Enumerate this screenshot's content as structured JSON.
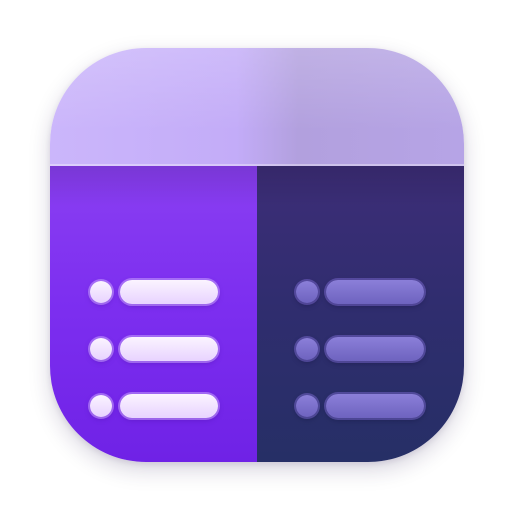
{
  "icon": {
    "name": "list-columns-app-icon",
    "colors": {
      "header": "#c3acf8",
      "left_column": "#7d2ff0",
      "right_column": "#2f2d6e",
      "light_item": "#f1e4ff",
      "dim_item": "#7b70cc"
    },
    "left_rows": [
      {
        "kind": "bullet-line"
      },
      {
        "kind": "bullet-line"
      },
      {
        "kind": "bullet-line"
      }
    ],
    "right_rows": [
      {
        "kind": "bullet-line"
      },
      {
        "kind": "bullet-line"
      },
      {
        "kind": "bullet-line"
      }
    ]
  }
}
